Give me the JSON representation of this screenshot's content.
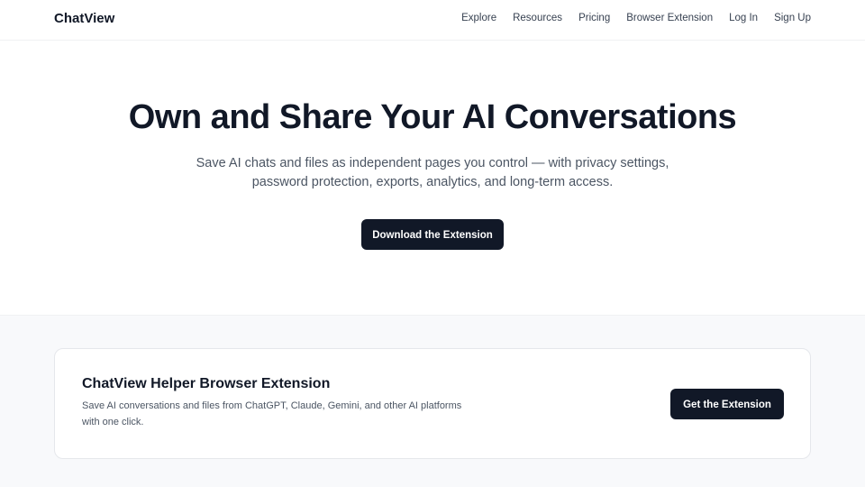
{
  "nav": {
    "brand": "ChatView",
    "links": [
      {
        "label": "Explore"
      },
      {
        "label": "Resources"
      },
      {
        "label": "Pricing"
      },
      {
        "label": "Browser Extension"
      },
      {
        "label": "Log In"
      },
      {
        "label": "Sign Up"
      }
    ]
  },
  "hero": {
    "title": "Own and Share Your AI Conversations",
    "subtitle": "Save AI chats and files as independent pages you control — with privacy settings, password protection, exports, analytics, and long-term access.",
    "cta_label": "Download the Extension"
  },
  "extension_card": {
    "title": "ChatView Helper Browser Extension",
    "description": "Save AI conversations and files from ChatGPT, Claude, Gemini, and other AI platforms with one click.",
    "cta_label": "Get the Extension"
  },
  "colors": {
    "primary_dark": "#111827",
    "section_background": "#f8f9fb",
    "muted_text": "#4b5563"
  }
}
